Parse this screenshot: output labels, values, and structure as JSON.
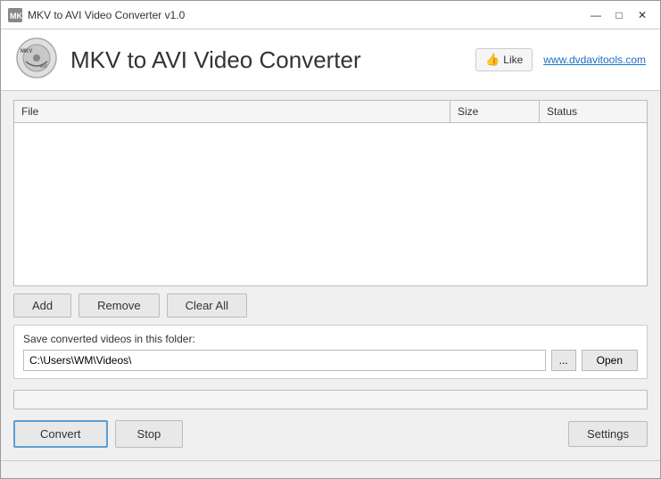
{
  "window": {
    "title": "MKV to AVI Video Converter v1.0"
  },
  "titlebar": {
    "title": "MKV to AVI Video Converter v1.0",
    "minimize_label": "—",
    "maximize_label": "□",
    "close_label": "✕"
  },
  "header": {
    "app_title": "MKV to AVI Video Converter",
    "like_label": "Like",
    "website_label": "www.dvdavitools.com"
  },
  "table": {
    "col_file": "File",
    "col_size": "Size",
    "col_status": "Status"
  },
  "buttons": {
    "add": "Add",
    "remove": "Remove",
    "clear_all": "Clear All",
    "open": "Open",
    "dots": "...",
    "convert": "Convert",
    "stop": "Stop",
    "settings": "Settings"
  },
  "save_section": {
    "label": "Save converted videos in this folder:",
    "path": "C:\\Users\\WM\\Videos\\"
  },
  "progress": {
    "value": 0
  }
}
